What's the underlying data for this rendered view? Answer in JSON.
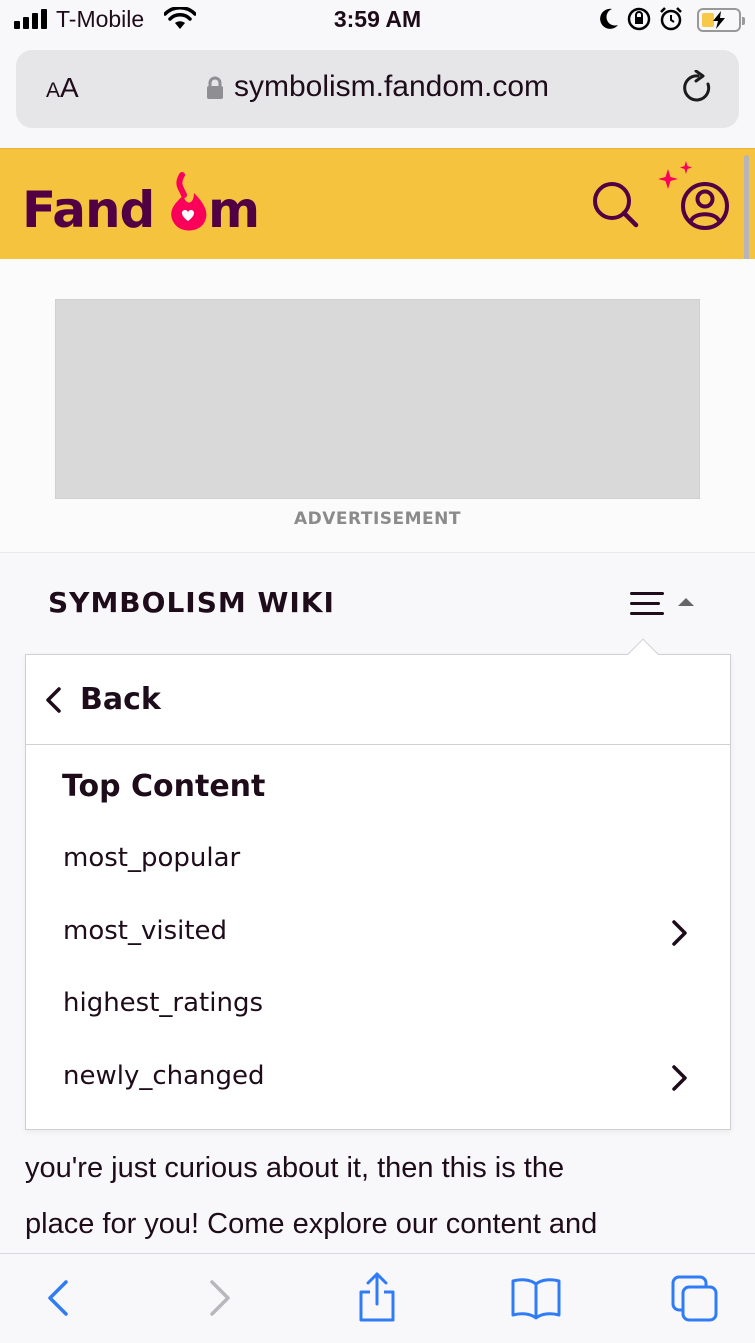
{
  "status_bar": {
    "carrier": "T-Mobile",
    "time": "3:59 AM",
    "icons": [
      "signal-icon",
      "wifi-icon",
      "moon-icon",
      "orientation-lock-icon",
      "alarm-icon",
      "battery-charging-icon"
    ]
  },
  "address_bar": {
    "text_size_label_small": "A",
    "text_size_label_large": "A",
    "url": "symbolism.fandom.com",
    "icons": [
      "lock-icon",
      "reload-icon"
    ]
  },
  "fandom_header": {
    "logo_text": "Fandom",
    "brand_color": "#f6c33e",
    "logo_color": "#520044",
    "accent_color": "#fa005a",
    "icons": [
      "search-icon",
      "user-icon",
      "sparkle-icon"
    ]
  },
  "ad": {
    "label": "ADVERTISEMENT"
  },
  "wiki": {
    "title": "SYMBOLISM WIKI",
    "menu_icon": "hamburger-menu-icon"
  },
  "dropdown": {
    "back_label": "Back",
    "heading": "Top Content",
    "items": [
      {
        "label": "most_popular",
        "has_submenu": false
      },
      {
        "label": "most_visited",
        "has_submenu": true
      },
      {
        "label": "highest_ratings",
        "has_submenu": false
      },
      {
        "label": "newly_changed",
        "has_submenu": true
      }
    ]
  },
  "article": {
    "line1": "you're just curious about it, then this is the",
    "line2": "place for you! Come explore our content and"
  },
  "toolbar": {
    "icons": [
      "back-icon",
      "forward-icon",
      "share-icon",
      "bookmarks-icon",
      "tabs-icon"
    ],
    "accent_color": "#2f7cf6"
  }
}
